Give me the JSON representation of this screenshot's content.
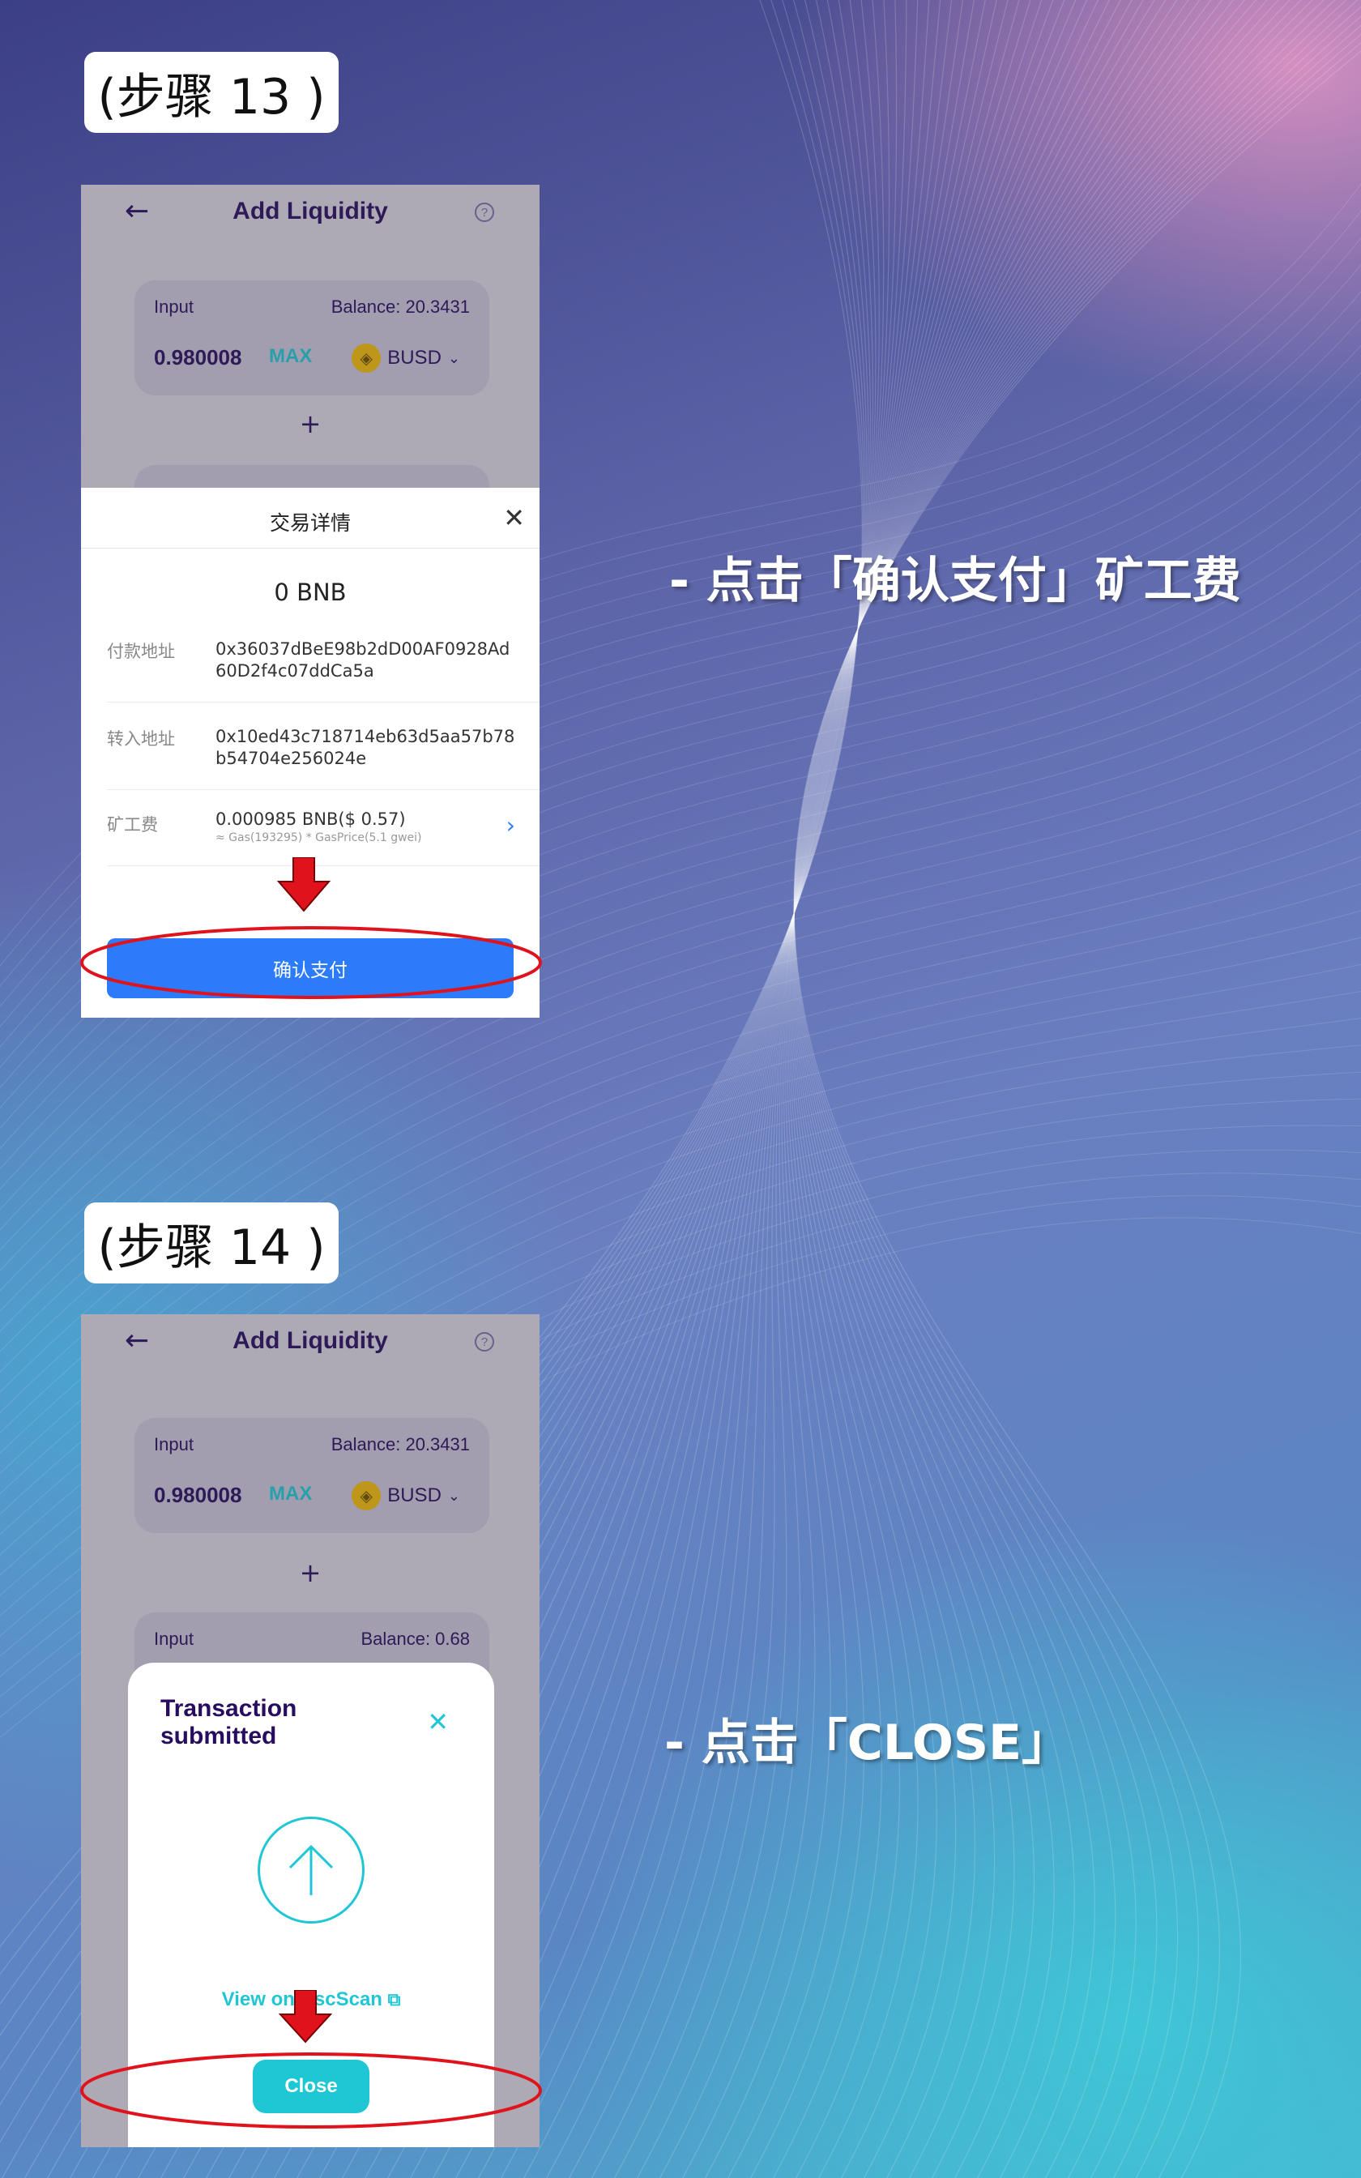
{
  "step13": {
    "label": "(步骤 13 )",
    "instruction": "-   点击「确认支付」矿工费",
    "app": {
      "title": "Add Liquidity",
      "input_label": "Input",
      "balance": "Balance: 20.3431",
      "amount": "0.980008",
      "max_label": "MAX",
      "token": "BUSD",
      "plus": "+"
    },
    "sheet": {
      "title": "交易详情",
      "amount": "0 BNB",
      "from_label": "付款地址",
      "from_value": "0x36037dBeE98b2dD00AF0928Ad60D2f4c07ddCa5a",
      "to_label": "转入地址",
      "to_value": "0x10ed43c718714eb63d5aa57b78b54704e256024e",
      "fee_label": "矿工费",
      "fee_value": "0.000985 BNB($ 0.57)",
      "fee_detail": "≈ Gas(193295) * GasPrice(5.1 gwei)",
      "confirm_label": "确认支付"
    }
  },
  "step14": {
    "label": "(步骤 14 )",
    "instruction": "-   点击「CLOSE」",
    "app": {
      "title": "Add Liquidity",
      "input_label": "Input",
      "balance": "Balance: 20.3431",
      "amount": "0.980008",
      "max_label": "MAX",
      "token": "BUSD",
      "plus": "+",
      "input2_label": "Input",
      "balance2": "Balance: 0.68"
    },
    "modal": {
      "title": "Transaction\nsubmitted",
      "view_link": "View on BscScan",
      "close_label": "Close"
    }
  },
  "colors": {
    "pancake_purple": "#280d5f",
    "pancake_teal": "#1fc7d4",
    "confirm_blue": "#2b7bfa",
    "annotation_red": "#e0121b"
  }
}
